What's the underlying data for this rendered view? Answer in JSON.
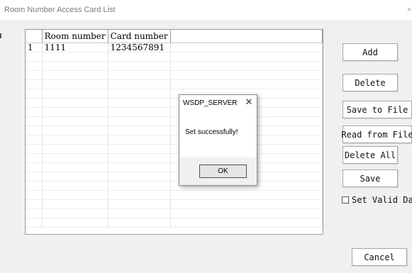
{
  "window": {
    "title": "Room Number Access Card List",
    "close_glyph": "×"
  },
  "table": {
    "columns": [
      "",
      "Room number",
      "Card number",
      ""
    ],
    "rows": [
      [
        "1",
        "1111",
        "1234567891",
        ""
      ],
      [
        "",
        "",
        "",
        ""
      ],
      [
        "",
        "",
        "",
        ""
      ],
      [
        "",
        "",
        "",
        ""
      ],
      [
        "",
        "",
        "",
        ""
      ],
      [
        "",
        "",
        "",
        ""
      ],
      [
        "",
        "",
        "",
        ""
      ],
      [
        "",
        "",
        "",
        ""
      ],
      [
        "",
        "",
        "",
        ""
      ],
      [
        "",
        "",
        "",
        ""
      ],
      [
        "",
        "",
        "",
        ""
      ],
      [
        "",
        "",
        "",
        ""
      ],
      [
        "",
        "",
        "",
        ""
      ],
      [
        "",
        "",
        "",
        ""
      ],
      [
        "",
        "",
        "",
        ""
      ],
      [
        "",
        "",
        "",
        ""
      ],
      [
        "",
        "",
        "",
        ""
      ],
      [
        "",
        "",
        "",
        ""
      ],
      [
        "",
        "",
        "",
        ""
      ],
      [
        "",
        "",
        "",
        ""
      ]
    ]
  },
  "buttons": {
    "add": "Add",
    "delete": "Delete",
    "save_to_file": "Save to File",
    "read_from_file": "Read from File",
    "delete_all": "Delete All",
    "save": "Save",
    "cancel": "Cancel"
  },
  "checkbox": {
    "label": "Set Valid Date",
    "checked": false
  },
  "dialog": {
    "title": "WSDP_SERVER",
    "close_glyph": "✕",
    "message": "Set successfully!",
    "ok_label": "OK"
  }
}
